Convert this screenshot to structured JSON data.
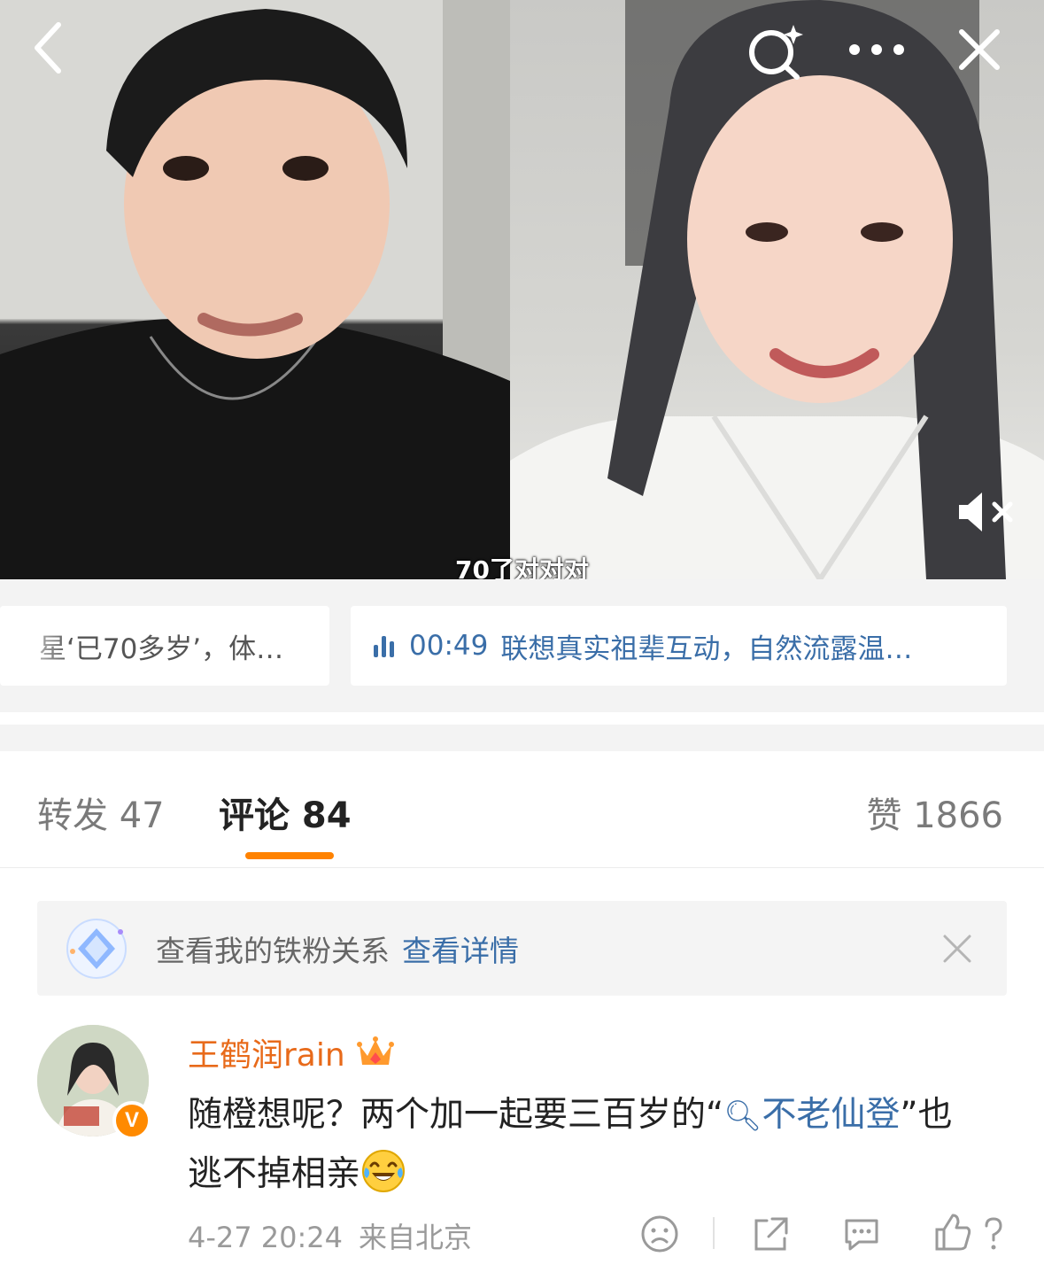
{
  "video": {
    "subtitle": "70了对对对",
    "icons": {
      "back": "chevron-left-icon",
      "search": "sparkle-search-icon",
      "more": "more-dots-icon",
      "close": "close-icon",
      "mute": "muted-speaker-icon"
    }
  },
  "chips": [
    {
      "label": "星‘已70多岁’，体…"
    },
    {
      "duration": "00:49",
      "label": "联想真实祖辈互动，自然流露温…"
    }
  ],
  "tabs": {
    "repost": "转发 47",
    "comment": "评论 84",
    "like": "赞 1866",
    "active_color": "#ff8200"
  },
  "fan_banner": {
    "text": "查看我的铁粉关系",
    "link": "查看详情"
  },
  "comment": {
    "username": "王鹤润rain",
    "verified_badge": "V",
    "text_before": "随橙想呢？两个加一起要三百岁的“",
    "topic": "不老仙登",
    "text_after": "”也逃不掉相亲",
    "emoji": "laughing-tears-emoji",
    "time": "4-27 20:24",
    "location": "来自北京",
    "username_color": "#e86a1a",
    "link_color": "#3a6ea8"
  }
}
